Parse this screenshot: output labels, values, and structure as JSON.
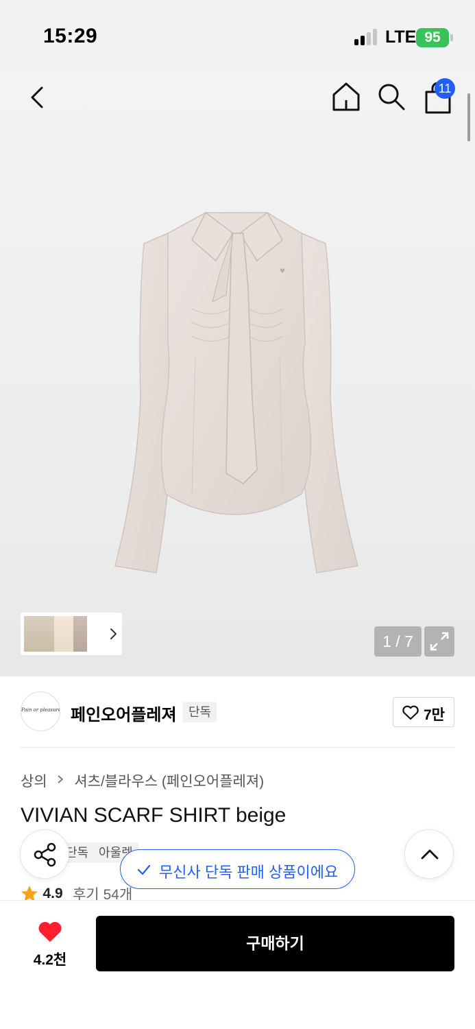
{
  "status_bar": {
    "time": "15:29",
    "network": "LTE",
    "battery": "95"
  },
  "header": {
    "cart_count": "11"
  },
  "gallery": {
    "page_counter": "1 / 7"
  },
  "brand": {
    "name": "페인오어플레져",
    "tag": "단독",
    "logo_text": "Pain or pleasure",
    "like_count": "7만"
  },
  "breadcrumb": {
    "category": "상의",
    "subcategory": "셔츠/블라우스 (페인오어플레져)"
  },
  "product": {
    "title": "VIVIAN SCARF SHIRT beige",
    "tags": [
      "단독",
      "아울렛"
    ],
    "rating": "4.9",
    "reviews": "후기 54개"
  },
  "toast": {
    "text": "무신사 단독 판매 상품이에요"
  },
  "bottom_bar": {
    "wish_count": "4.2천",
    "buy_label": "구매하기"
  },
  "colors": {
    "accent_blue": "#1f5eff",
    "heart_red": "#ff1f2f",
    "star_orange": "#f7a21b",
    "battery_green": "#3ac25a"
  },
  "icons": [
    "back-icon",
    "home-icon",
    "search-icon",
    "cart-icon",
    "chevron-right-icon",
    "expand-icon",
    "heart-outline-icon",
    "share-icon",
    "chevron-up-icon",
    "check-icon",
    "star-icon",
    "heart-filled-icon"
  ]
}
